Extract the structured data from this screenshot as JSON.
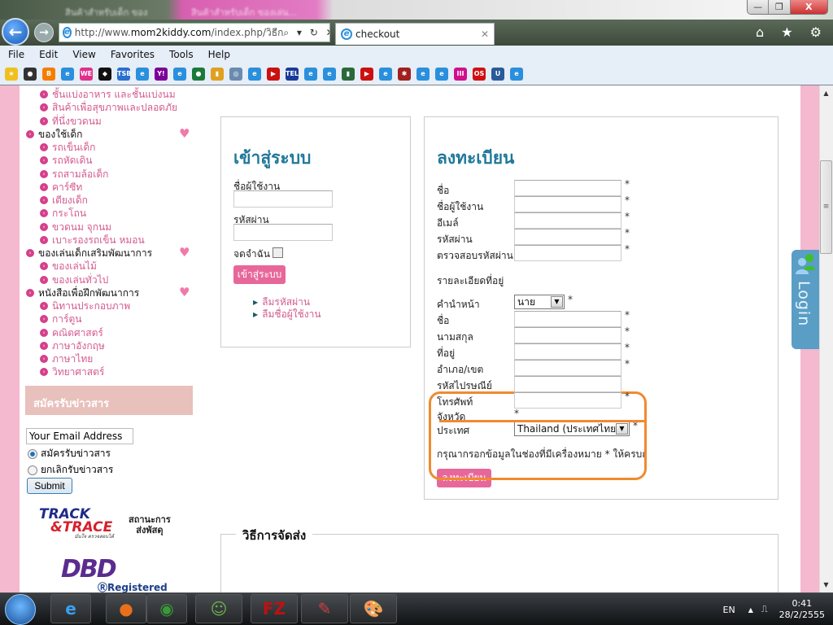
{
  "browser": {
    "background_tabs": [
      "สินค้าสำหรับเด็ก ของเล่น...",
      "สินค้าสำหรับเด็ก ของเล่น..."
    ],
    "url_prefix": "http://www.",
    "url_domain": "mom2kiddy.com",
    "url_path": "/index.php/วิธีก",
    "address_controls": "⌕ ▾ ↻ ✕",
    "active_tab": "checkout",
    "window_controls": {
      "minimize": "—",
      "restore": "❐",
      "close": "X"
    },
    "toolbar_icons": "⌂ ★ ⚙",
    "menu": [
      "File",
      "Edit",
      "View",
      "Favorites",
      "Tools",
      "Help"
    ],
    "favorites_icons": [
      {
        "icon": "favorites-star",
        "label": "★",
        "color": "#f0c020"
      },
      {
        "icon": "ghost",
        "label": "●",
        "color": "#333333"
      },
      {
        "icon": "blogger",
        "label": "B",
        "color": "#f57d00"
      },
      {
        "icon": "ie-page",
        "label": "e",
        "color": "#2a8fdc"
      },
      {
        "icon": "we",
        "label": "WE",
        "color": "#e0308a"
      },
      {
        "icon": "bird",
        "label": "◆",
        "color": "#111111"
      },
      {
        "icon": "tsb",
        "label": "TSB",
        "color": "#2a6fd0"
      },
      {
        "icon": "ie-page",
        "label": "e",
        "color": "#2a8fdc"
      },
      {
        "icon": "yahoo",
        "label": "Y!",
        "color": "#7b0099"
      },
      {
        "icon": "ie-page",
        "label": "e",
        "color": "#2a8fdc"
      },
      {
        "icon": "globe",
        "label": "●",
        "color": "#1a7a3a"
      },
      {
        "icon": "chart",
        "label": "▮",
        "color": "#e0a020"
      },
      {
        "icon": "compass",
        "label": "◎",
        "color": "#6a8ab0"
      },
      {
        "icon": "ie-page",
        "label": "e",
        "color": "#2a8fdc"
      },
      {
        "icon": "youtube",
        "label": "▶",
        "color": "#cc1010"
      },
      {
        "icon": "tel",
        "label": "TEL",
        "color": "#1a3a9a"
      },
      {
        "icon": "ie-page",
        "label": "e",
        "color": "#2a8fdc"
      },
      {
        "icon": "ie-page",
        "label": "e",
        "color": "#2a8fdc"
      },
      {
        "icon": "signal",
        "label": "▮",
        "color": "#2a6a3a"
      },
      {
        "icon": "youtube",
        "label": "▶",
        "color": "#cc1010"
      },
      {
        "icon": "ie-page",
        "label": "e",
        "color": "#2a8fdc"
      },
      {
        "icon": "robot",
        "label": "✱",
        "color": "#a02020"
      },
      {
        "icon": "ie-page",
        "label": "e",
        "color": "#2a8fdc"
      },
      {
        "icon": "ie-page",
        "label": "e",
        "color": "#2a8fdc"
      },
      {
        "icon": "piano",
        "label": "III",
        "color": "#d0108a"
      },
      {
        "icon": "lastfm",
        "label": "OS",
        "color": "#d01010"
      },
      {
        "icon": "headphones",
        "label": "U",
        "color": "#2a5a9a"
      },
      {
        "icon": "ie-page",
        "label": "e",
        "color": "#2a8fdc"
      }
    ]
  },
  "sidebar": {
    "items": [
      {
        "label": "ชั้นแบ่งอาหาร และชั้นแบ่งนม",
        "level": "sub"
      },
      {
        "label": "สินค้าเพื่อสุขภาพและปลอดภัย",
        "level": "sub"
      },
      {
        "label": "ที่นึ่งขวดนม",
        "level": "sub"
      },
      {
        "label": "ของใช้เด็ก",
        "level": "top",
        "heart": true
      },
      {
        "label": "รถเข็นเด็ก",
        "level": "sub"
      },
      {
        "label": "รถหัดเดิน",
        "level": "sub"
      },
      {
        "label": "รถสามล้อเด็ก",
        "level": "sub"
      },
      {
        "label": "คาร์ซีท",
        "level": "sub"
      },
      {
        "label": "เตียงเด็ก",
        "level": "sub"
      },
      {
        "label": "กระโถน",
        "level": "sub"
      },
      {
        "label": "ขวดนม จุกนม",
        "level": "sub"
      },
      {
        "label": "เบาะรองรถเข็น หมอน",
        "level": "sub"
      },
      {
        "label": "ของเล่นเด็กเสริมพัฒนาการ",
        "level": "top",
        "heart": true
      },
      {
        "label": "ของเล่นไม้",
        "level": "sub"
      },
      {
        "label": "ของเล่นทั่วไป",
        "level": "sub"
      },
      {
        "label": "หนังสือเพื่อฝึกพัฒนาการ",
        "level": "top",
        "heart": true
      },
      {
        "label": "นิทานประกอบภาพ",
        "level": "sub"
      },
      {
        "label": "การ์ตูน",
        "level": "sub"
      },
      {
        "label": "คณิตศาสตร์",
        "level": "sub"
      },
      {
        "label": "ภาษาอังกฤษ",
        "level": "sub"
      },
      {
        "label": "ภาษาไทย",
        "level": "sub"
      },
      {
        "label": "วิทยาศาสตร์",
        "level": "sub"
      }
    ],
    "newsletter": {
      "heading": "สมัครรับข่าวสาร",
      "email_value": "Your Email Address",
      "subscribe_label": "สมัครรับข่าวสาร",
      "unsubscribe_label": "ยกเลิกรับข่าวสาร",
      "selected": "subscribe",
      "submit_label": "Submit"
    },
    "track": {
      "logo_line1": "TRACK",
      "logo_line2": "&TRACE",
      "logo_tagline": "มั่นใจ ตรวจสอบได้",
      "text_line1": "สถานะการ",
      "text_line2": "ส่งพัสดุ"
    },
    "dbd": {
      "logo": "DBD",
      "registered": "Registered"
    }
  },
  "login": {
    "title": "เข้าสู่ระบบ",
    "username_label": "ชื่อผู้ใช้งาน",
    "password_label": "รหัสผ่าน",
    "remember_label": "จดจำฉัน",
    "submit_label": "เข้าสู่ระบบ",
    "forgot_password": "ลืมรหัสผ่าน",
    "forgot_username": "ลืมชื่อผู้ใช้งาน"
  },
  "register": {
    "title": "ลงทะเบียน",
    "account_fields": [
      {
        "label": "ชื่อ",
        "required": "*"
      },
      {
        "label": "ชื่อผู้ใช้งาน",
        "required": "*"
      },
      {
        "label": "อีเมล์",
        "required": "*"
      },
      {
        "label": "รหัสผ่าน",
        "required": "*"
      },
      {
        "label": "ตรวจสอบรหัสผ่าน",
        "required": "*"
      }
    ],
    "address_heading": "รายละเอียดที่อยู่",
    "prefix_label": "คำนำหน้า",
    "prefix_value": "นาย",
    "address_fields": [
      {
        "label": "ชื่อ",
        "required": "*"
      },
      {
        "label": "นามสกุล",
        "required": "*"
      },
      {
        "label": "ที่อยู่",
        "required": "*"
      },
      {
        "label": "อำเภอ/เขต",
        "required": "*"
      },
      {
        "label": "รหัสไปรษณีย์",
        "required": ""
      },
      {
        "label": "โทรศัพท์",
        "required": "*"
      }
    ],
    "province_label": "จังหวัด",
    "province_required": "*",
    "country_label": "ประเทศ",
    "country_value": "Thailand (ประเทศไทย)",
    "required_mark": "*",
    "note": "กรุณากรอกข้อมูลในช่องที่มีเครื่องหมาย * ให้ครบถ้วน",
    "submit_label": "ลงทะเบียน"
  },
  "shipping": {
    "title": "วิธีการจัดส่ง"
  },
  "login_tab": {
    "label": "Login"
  },
  "annotation_color": "#f08a30",
  "taskbar": {
    "apps": [
      {
        "icon": "internet-explorer",
        "glyph": "e",
        "color": "#3aa0f0"
      },
      {
        "icon": "firefox",
        "glyph": "●",
        "color": "#e8701a"
      },
      {
        "icon": "chrome",
        "glyph": "◉",
        "color": "#3a9a3a"
      },
      {
        "icon": "messenger",
        "glyph": "☺",
        "color": "#6ab04a"
      },
      {
        "icon": "filezilla",
        "glyph": "FZ",
        "color": "#c01010"
      },
      {
        "icon": "notepad",
        "glyph": "✎",
        "color": "#d04040"
      },
      {
        "icon": "paint",
        "glyph": "🎨",
        "color": "#8ab0d0"
      }
    ],
    "language": "EN",
    "time": "0:41",
    "date": "28/2/2555"
  }
}
